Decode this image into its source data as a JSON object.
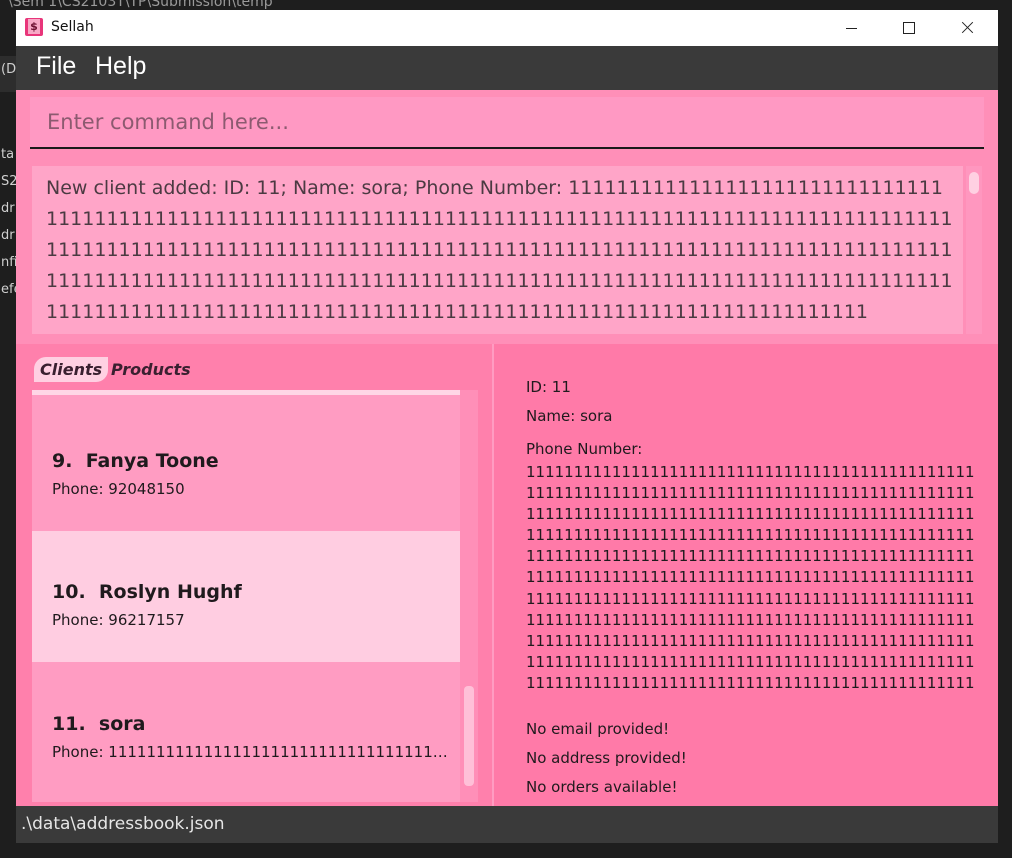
{
  "background": {
    "path_text": "\\Sem 1\\CS2103T\\TP\\Submission\\temp",
    "side_fragments": [
      "(D",
      "ta",
      "S2",
      "dr",
      "dr",
      "nfi",
      "efe"
    ]
  },
  "window": {
    "title": "Sellah",
    "icon_glyph": "$",
    "controls": [
      "minimize-icon",
      "maximize-icon",
      "close-icon"
    ]
  },
  "menu": {
    "items": [
      "File",
      "Help"
    ]
  },
  "command": {
    "placeholder": "Enter command here...",
    "value": ""
  },
  "result": {
    "message": "New client added: ID: 11; Name: sora; Phone Number: 111111111111111111111111111111111111111111111111111111111111111111111111111111111111111111111111111111111111111111111111111111111111111111111111111111111111111111111111111111111111111111111111111111111111111111111111111111111111111111111111111111111111111111111111111111111111111111111111111111111111111111111111111111111111"
  },
  "tabs": {
    "clients": "Clients",
    "products": "Products",
    "selected": "Clients"
  },
  "clients": [
    {
      "index": "9.",
      "name": "Fanya Toone",
      "phone": "Phone: 92048150",
      "selected": false
    },
    {
      "index": "10.",
      "name": "Roslyn Hughf",
      "phone": "Phone: 96217157",
      "selected": true
    },
    {
      "index": "11.",
      "name": "sora",
      "phone": "Phone: 111111111111111111111111111111111111111111111111111111111111111111111111111",
      "selected": false
    }
  ],
  "detail": {
    "id": "ID: 11",
    "name": "Name: sora",
    "phone_label": "Phone Number:",
    "phone_value": "1111111111111111111111111111111111111111111111111111111111111111111111111111111111111111111111111111111111111111111111111111111111111111111111111111111111111111111111111111111111111111111111111111111111111111111111111111111111111111111111111111111111111111111111111111111111111111111111111111111111111111111111111111111111111111111111111111111111111111111111111111111111111111111111111111111111111111111111111111111111111111111111111111111111111111111111111111111111111111111111111111111111111111111111111111111111111111111111111111111111111111111111111111111111111111111111111111111111111111111111111111111111111111111111…",
    "email": "No email provided!",
    "address": "No address provided!",
    "orders": "No orders available!"
  },
  "status": {
    "path": ".\\data\\addressbook.json"
  },
  "colors": {
    "window_bg": "#ff7aa8",
    "menubar": "#3a3a3a",
    "selected_card": "#ffcde1"
  }
}
